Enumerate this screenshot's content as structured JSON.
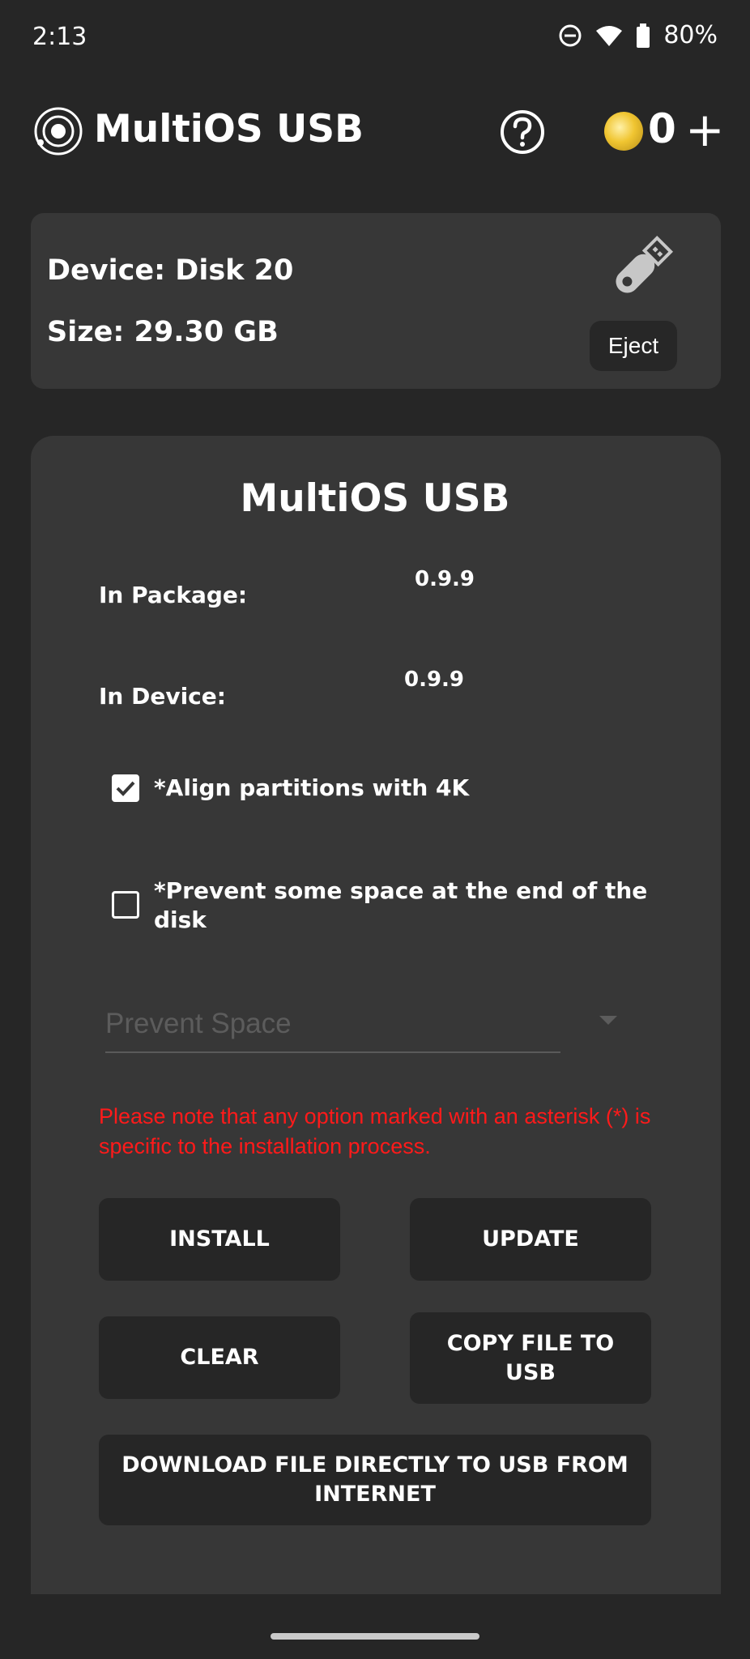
{
  "status_bar": {
    "time": "2:13",
    "battery": "80%",
    "icons": [
      "do-not-disturb-icon",
      "wifi-icon",
      "battery-icon"
    ]
  },
  "header": {
    "title": "MultiOS USB",
    "coin_count": "0",
    "plus": "+",
    "icons": [
      "app-logo-icon",
      "help-icon",
      "coin-icon",
      "plus-icon"
    ]
  },
  "device": {
    "device_line": "Device: Disk 20",
    "size_line": "Size: 29.30 GB",
    "eject_label": "Eject",
    "icon": "usb-drive-icon"
  },
  "panel": {
    "title": "MultiOS USB",
    "in_package_label": "In Package:",
    "in_package_value": "0.9.9",
    "in_device_label": "In Device:",
    "in_device_value": "0.9.9",
    "align_label": "*Align partitions with 4K",
    "align_checked": true,
    "prevent_label": "*Prevent some space at the end of the disk",
    "prevent_checked": false,
    "prevent_space_placeholder": "Prevent Space",
    "note": "Please note that any option marked with an asterisk (*) is specific to the installation process.",
    "note_color": "#ff1a1a",
    "buttons": {
      "install": "INSTALL",
      "update": "UPDATE",
      "clear": "CLEAR",
      "copy_file": "COPY FILE TO USB",
      "download": "DOWNLOAD FILE DIRECTLY TO USB FROM INTERNET"
    }
  },
  "colors": {
    "background": "#262626",
    "card": "#373737",
    "button": "#262626",
    "coin_gold": "#f0c531"
  }
}
